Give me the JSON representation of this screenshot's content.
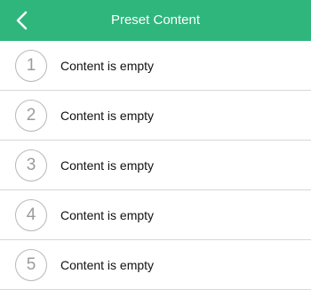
{
  "header": {
    "title": "Preset Content",
    "back_icon": "chevron-left-icon",
    "background_color": "#2eb67d"
  },
  "list": {
    "items": [
      {
        "number": "1",
        "label": "Content is empty"
      },
      {
        "number": "2",
        "label": "Content is empty"
      },
      {
        "number": "3",
        "label": "Content is empty"
      },
      {
        "number": "4",
        "label": "Content is empty"
      },
      {
        "number": "5",
        "label": "Content is empty"
      }
    ]
  }
}
